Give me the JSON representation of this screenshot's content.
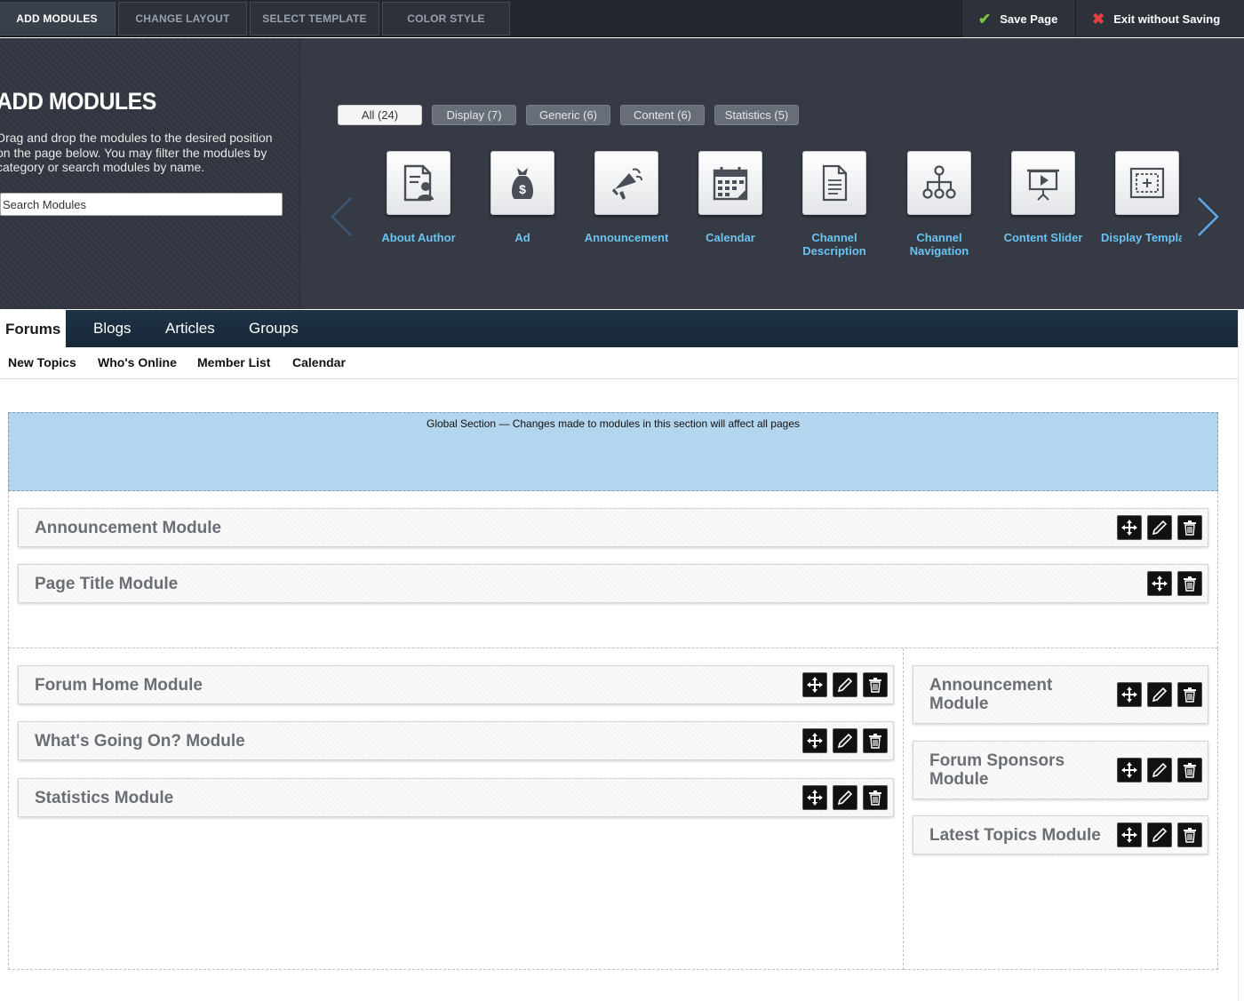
{
  "toolbar": {
    "tabs": [
      {
        "label": "ADD MODULES",
        "active": true
      },
      {
        "label": "CHANGE LAYOUT",
        "active": false
      },
      {
        "label": "SELECT TEMPLATE",
        "active": false
      },
      {
        "label": "COLOR STYLE",
        "active": false
      }
    ],
    "save_label": "Save Page",
    "exit_label": "Exit without Saving"
  },
  "add_modules": {
    "title": "ADD MODULES",
    "description": "Drag and drop the modules to the desired position on the page below. You may filter the modules by category or search modules by name.",
    "search_placeholder": "Search Modules",
    "filters": [
      {
        "label": "All (24)",
        "active": true
      },
      {
        "label": "Display (7)",
        "active": false
      },
      {
        "label": "Generic (6)",
        "active": false
      },
      {
        "label": "Content (6)",
        "active": false
      },
      {
        "label": "Statistics (5)",
        "active": false
      }
    ],
    "modules": [
      {
        "label": "About Author",
        "icon": "author-icon"
      },
      {
        "label": "Ad",
        "icon": "money-bag-icon"
      },
      {
        "label": "Announcement",
        "icon": "megaphone-icon"
      },
      {
        "label": "Calendar",
        "icon": "calendar-icon"
      },
      {
        "label": "Channel\nDescription",
        "icon": "document-icon"
      },
      {
        "label": "Channel\nNavigation",
        "icon": "hierarchy-icon"
      },
      {
        "label": "Content Slider",
        "icon": "presentation-icon"
      },
      {
        "label": "Display Templa",
        "icon": "template-icon"
      }
    ]
  },
  "nav": {
    "items": [
      {
        "label": "Forums",
        "active": true
      },
      {
        "label": "Blogs",
        "active": false
      },
      {
        "label": "Articles",
        "active": false
      },
      {
        "label": "Groups",
        "active": false
      }
    ],
    "subitems": [
      "New Topics",
      "Who's Online",
      "Member List",
      "Calendar"
    ]
  },
  "layout": {
    "global_note": "Global Section — Changes made to modules in this section will affect all pages",
    "top_modules": [
      {
        "title": "Announcement Module",
        "controls": [
          "move",
          "edit",
          "delete"
        ]
      },
      {
        "title": "Page Title Module",
        "controls": [
          "move",
          "delete"
        ]
      }
    ],
    "left_modules": [
      {
        "title": "Forum Home Module",
        "controls": [
          "move",
          "edit",
          "delete"
        ]
      },
      {
        "title": "What's Going On? Module",
        "controls": [
          "move",
          "edit",
          "delete"
        ]
      },
      {
        "title": "Statistics Module",
        "controls": [
          "move",
          "edit",
          "delete"
        ]
      }
    ],
    "right_modules": [
      {
        "title": "Announcement\nModule",
        "controls": [
          "move",
          "edit",
          "delete"
        ]
      },
      {
        "title": "Forum Sponsors\nModule",
        "controls": [
          "move",
          "edit",
          "delete"
        ]
      },
      {
        "title": "Latest Topics Module",
        "controls": [
          "move",
          "edit",
          "delete"
        ]
      }
    ]
  },
  "colors": {
    "toolbar_bg": "#23272e",
    "panel_bg": "#353a44",
    "link_blue": "#6cc2f0",
    "nav_bg": "#1f3347",
    "global_bg": "#b4d5ee",
    "save_check": "#7cc444",
    "exit_x": "#e04040"
  }
}
